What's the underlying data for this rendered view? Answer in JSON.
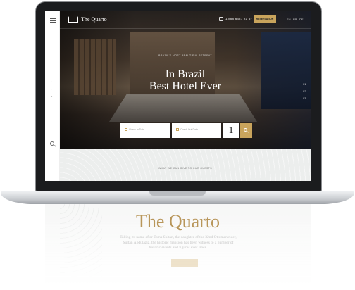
{
  "site": {
    "logo_text": "The Quarto",
    "phone": "1 888 6427 21 57",
    "reservation_label": "RESERVATION",
    "languages": [
      "EN",
      "FR",
      "DE"
    ]
  },
  "sidebar": {
    "social": [
      "f",
      "t",
      "o"
    ]
  },
  "hero": {
    "tagline": "BRAZIL'S MOST BEAUTIFUL RETREAT",
    "title_line1": "In Brazil",
    "title_line2": "Best Hotel Ever",
    "slides": [
      "01",
      "02",
      "03"
    ]
  },
  "booking": {
    "checkin_placeholder": "Check In Date",
    "checkout_placeholder": "Check Out Date",
    "guests": "1"
  },
  "section": {
    "kicker": "WHAT WE CAN GIVE TO OUR GUESTS",
    "title": "The Quarto",
    "text": "Taking its name after Esma Sultan, the daughter of the 32nd Ottoman ruler, Sultan Abdülaziz, the historic mansion has been witness to a number of historic events and figures ever since."
  },
  "colors": {
    "accent": "#c9a45c",
    "title_gold": "#b8965a"
  }
}
